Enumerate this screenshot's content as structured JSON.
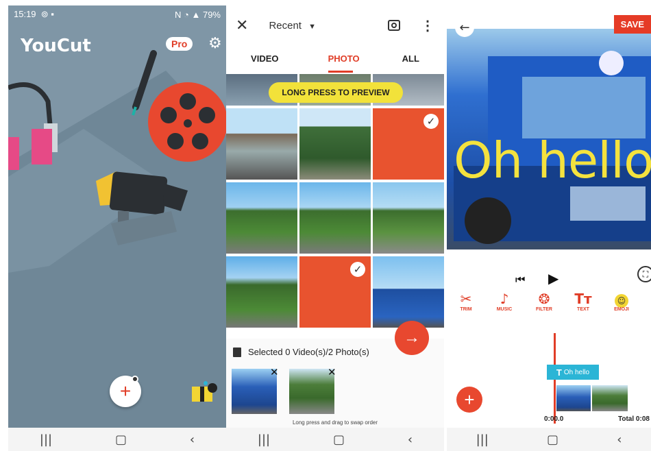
{
  "screen1": {
    "status_time": "15:19",
    "status_battery": "79%",
    "app_name": "YouCut",
    "pro_badge": "Pro",
    "settings_icon": "gear-icon",
    "add_icon": "plus-icon",
    "gift_icon": "gift-icon"
  },
  "screen2": {
    "close_icon": "close-icon",
    "dropdown_label": "Recent",
    "camera_icon": "camera-icon",
    "more_icon": "more-vert-icon",
    "tabs": [
      "VIDEO",
      "PHOTO",
      "ALL"
    ],
    "active_tab": "PHOTO",
    "banner": "LONG PRESS TO PREVIEW",
    "selected_text": "Selected 0 Video(s)/2 Photo(s)",
    "hint": "Long press and drag to swap order",
    "next_icon": "arrow-right-icon"
  },
  "screen3": {
    "back_icon": "arrow-left-icon",
    "save_label": "SAVE",
    "overlay_text": "Oh hello",
    "tools": [
      {
        "icon": "scissors-icon",
        "label": "TRIM"
      },
      {
        "icon": "music-note-icon",
        "label": "MUSIC"
      },
      {
        "icon": "filter-icon",
        "label": "FILTER"
      },
      {
        "icon": "text-icon",
        "label": "TEXT"
      },
      {
        "icon": "emoji-icon",
        "label": "EMOJI"
      }
    ],
    "text_clip_label": "Oh hello",
    "current_time": "0:00.0",
    "total_time": "Total 0:08"
  },
  "colors": {
    "accent": "#e03d27",
    "banner_yellow": "#f2e23a",
    "splash_background": "#7f96a6",
    "clip_cyan": "#2bb5d6"
  }
}
